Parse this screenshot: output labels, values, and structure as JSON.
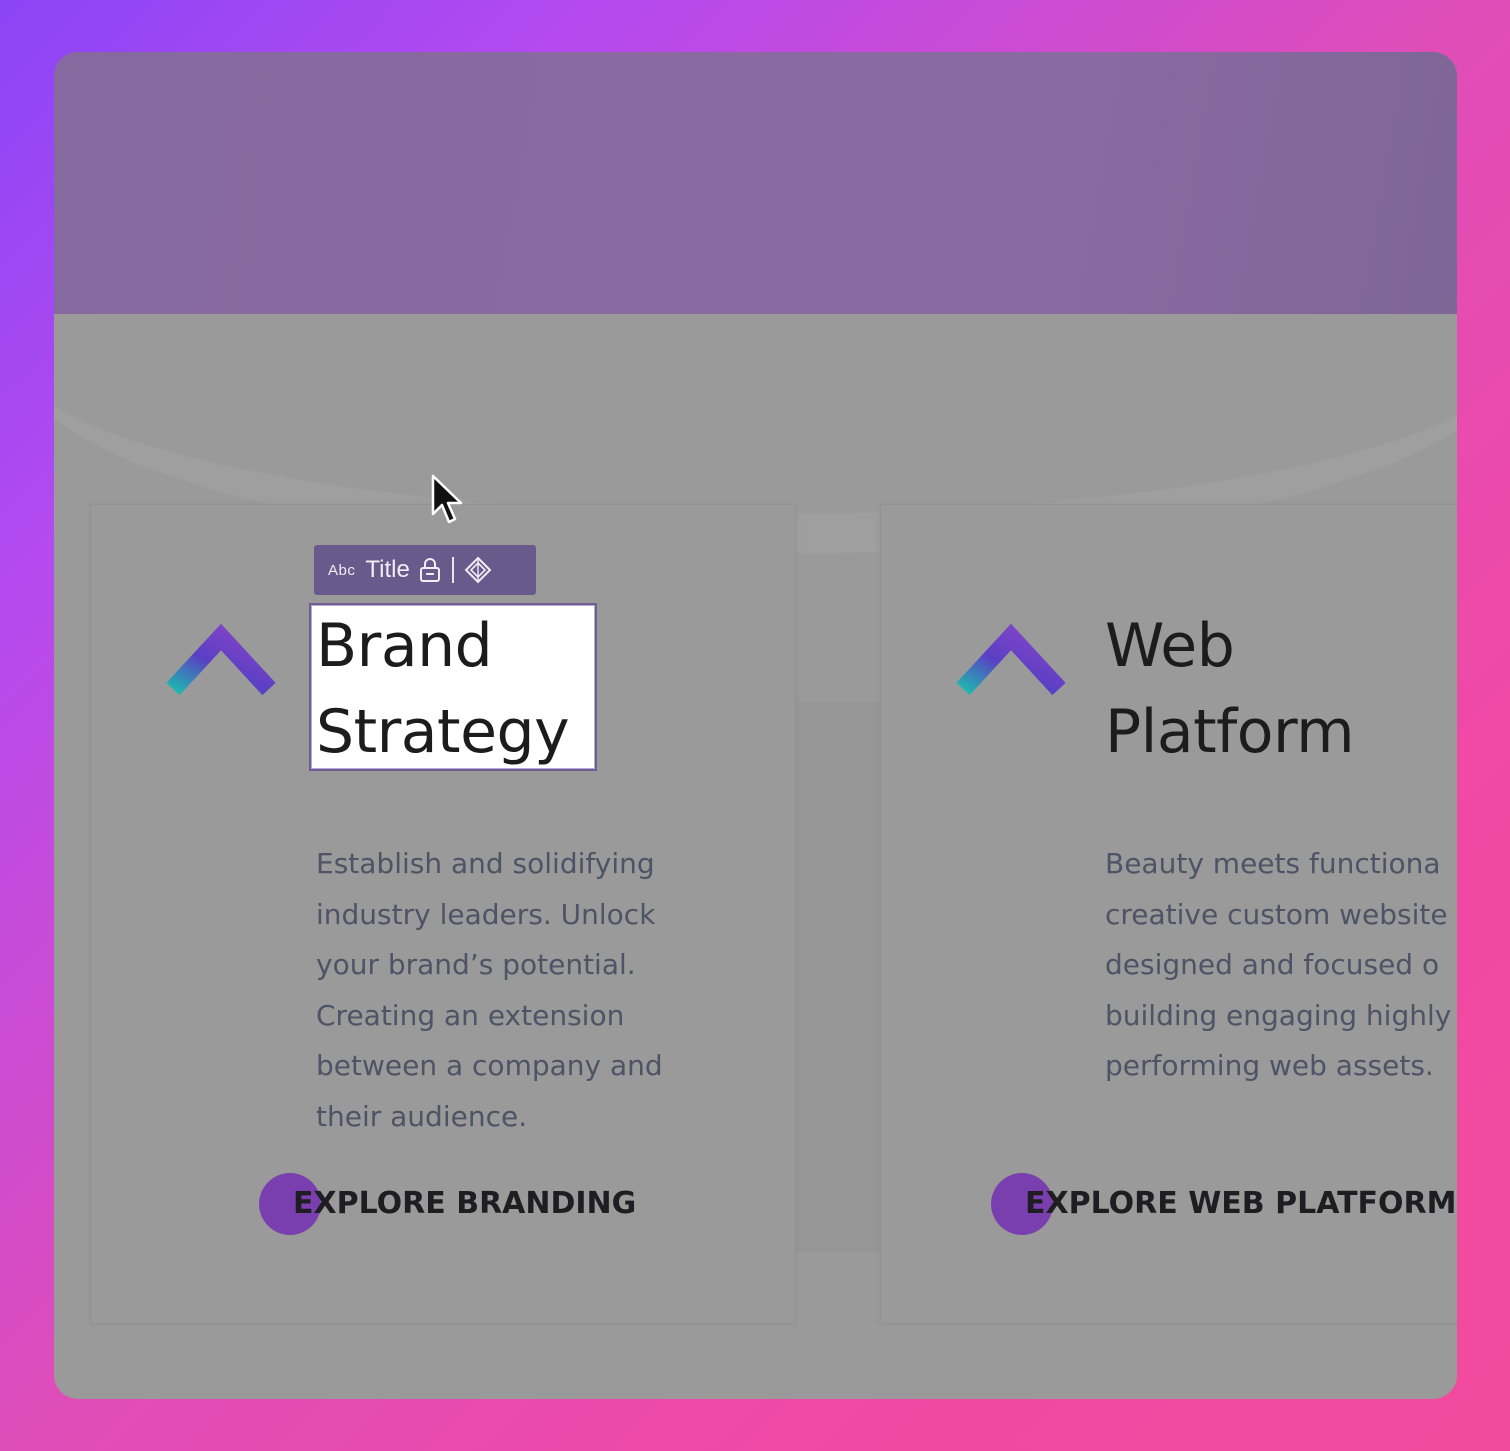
{
  "colors": {
    "hero": "#8a6aa0",
    "page_bg": "#9a9a9a",
    "accent_dot": "#7a3fae",
    "toolbar_bg": "#6a5a8c",
    "selection_border": "#6e5e92",
    "chevron_gradient": [
      "#1fb5b0",
      "#5a3fc4",
      "#8a46c8"
    ]
  },
  "toolbar": {
    "type_label": "Abc",
    "element_label": "Title",
    "lock_icon": "lock-icon",
    "component_icon": "component-diamond-icon"
  },
  "cards": [
    {
      "title_lines": [
        "Brand",
        "Strategy"
      ],
      "description_lines": [
        "Establish and solidifying",
        "industry leaders. Unlock",
        "your brand’s potential.",
        "Creating an extension",
        "between a company and",
        "their audience."
      ],
      "cta": "EXPLORE BRANDING",
      "icon": "chevron-up-icon",
      "selected": true
    },
    {
      "title_lines": [
        "Web",
        "Platform"
      ],
      "description_lines": [
        "Beauty meets functiona",
        "creative custom website",
        "designed and focused o",
        "building engaging highly",
        "performing web assets."
      ],
      "cta": "EXPLORE WEB PLATFORMS",
      "icon": "chevron-up-icon",
      "selected": false
    }
  ]
}
